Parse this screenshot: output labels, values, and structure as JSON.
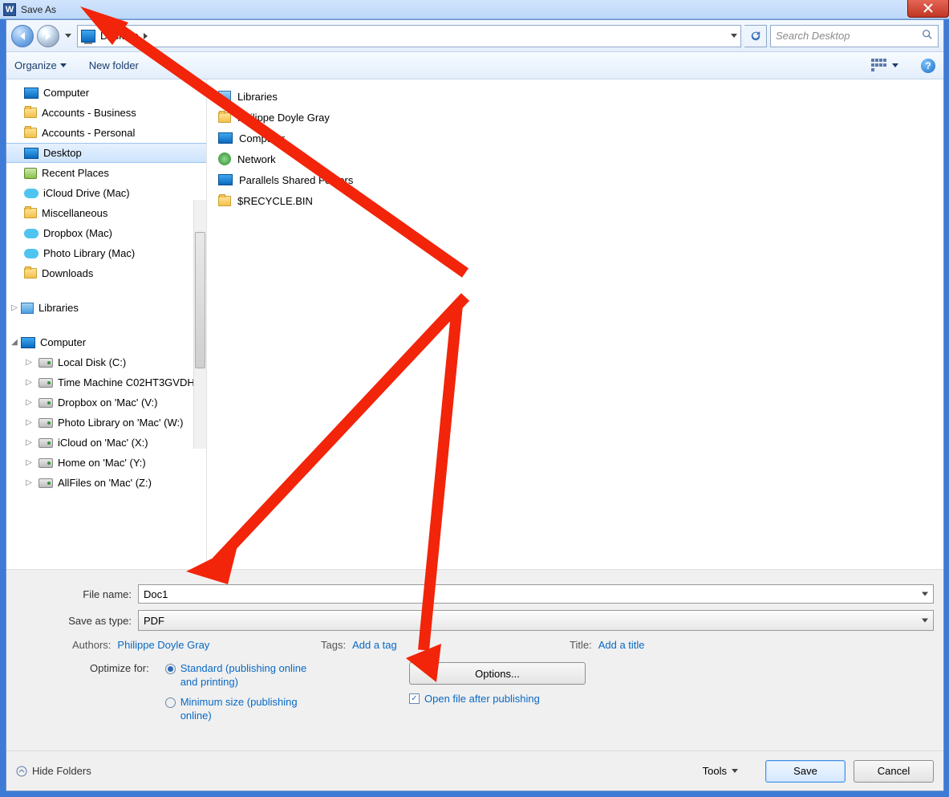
{
  "title": "Save As",
  "close_btn": "Close",
  "nav": {
    "back": "Back",
    "forward": "Forward",
    "location": "Desktop",
    "refresh": "Refresh",
    "search_placeholder": "Search Desktop"
  },
  "toolbar": {
    "organize": "Organize",
    "new_folder": "New folder",
    "views": "Views",
    "help": "?"
  },
  "tree": {
    "favorites": [
      {
        "icon": "computer",
        "label": "Computer"
      },
      {
        "icon": "folder",
        "label": "Accounts - Business"
      },
      {
        "icon": "folder",
        "label": "Accounts - Personal"
      },
      {
        "icon": "monitor",
        "label": "Desktop",
        "selected": true
      },
      {
        "icon": "recent",
        "label": "Recent Places"
      },
      {
        "icon": "cloud",
        "label": "iCloud Drive (Mac)"
      },
      {
        "icon": "folder",
        "label": "Miscellaneous"
      },
      {
        "icon": "cloud",
        "label": "Dropbox (Mac)"
      },
      {
        "icon": "cloud",
        "label": "Photo Library (Mac)"
      },
      {
        "icon": "folder",
        "label": "Downloads"
      }
    ],
    "libraries_label": "Libraries",
    "computer_label": "Computer",
    "drives": [
      "Local Disk (C:)",
      "Time Machine C02HT3GVDH",
      "Dropbox on 'Mac' (V:)",
      "Photo Library on 'Mac' (W:)",
      "iCloud on 'Mac' (X:)",
      "Home on 'Mac' (Y:)",
      "AllFiles on 'Mac' (Z:)"
    ]
  },
  "files": [
    {
      "icon": "lib",
      "label": "Libraries"
    },
    {
      "icon": "user",
      "label": "Philippe Doyle Gray"
    },
    {
      "icon": "computer",
      "label": "Computer"
    },
    {
      "icon": "net",
      "label": "Network"
    },
    {
      "icon": "psf",
      "label": "Parallels Shared Folders"
    },
    {
      "icon": "folder",
      "label": "$RECYCLE.BIN"
    }
  ],
  "form": {
    "filename_label": "File name:",
    "filename_value": "Doc1",
    "type_label": "Save as type:",
    "type_value": "PDF",
    "authors_label": "Authors:",
    "authors_value": "Philippe Doyle Gray",
    "tags_label": "Tags:",
    "tags_value": "Add a tag",
    "title_label": "Title:",
    "title_value": "Add a title",
    "optimize_label": "Optimize for:",
    "opt_standard": "Standard (publishing online and printing)",
    "opt_minimum": "Minimum size (publishing online)",
    "options_btn": "Options...",
    "open_after": "Open file after publishing"
  },
  "footer": {
    "hide_folders": "Hide Folders",
    "tools": "Tools",
    "save": "Save",
    "cancel": "Cancel"
  }
}
